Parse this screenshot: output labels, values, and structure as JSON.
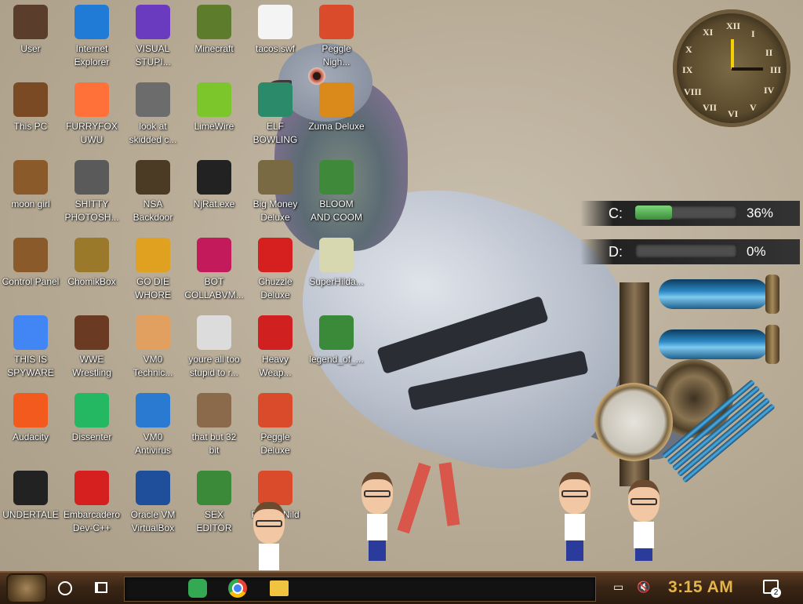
{
  "desktop": {
    "icons": [
      {
        "label": "User",
        "col": 0,
        "row": 0,
        "color": "#5a3e2b"
      },
      {
        "label": "Internet\nExplorer",
        "col": 1,
        "row": 0,
        "color": "#1f7bd6"
      },
      {
        "label": "VISUAL\nSTUPI...",
        "col": 2,
        "row": 0,
        "color": "#6b3bbf"
      },
      {
        "label": "Minecraft",
        "col": 3,
        "row": 0,
        "color": "#5d7d2c"
      },
      {
        "label": "tacos.swf",
        "col": 4,
        "row": 0,
        "color": "#f4f4f4"
      },
      {
        "label": "Peggle\nNigh...",
        "col": 5,
        "row": 0,
        "color": "#d94b2b"
      },
      {
        "label": "This PC",
        "col": 0,
        "row": 1,
        "color": "#7a4a24"
      },
      {
        "label": "FURRYFOX\nUWU",
        "col": 1,
        "row": 1,
        "color": "#ff7139"
      },
      {
        "label": "look at\nskidded c...",
        "col": 2,
        "row": 1,
        "color": "#6c6c6c"
      },
      {
        "label": "LimeWire",
        "col": 3,
        "row": 1,
        "color": "#7cc52a"
      },
      {
        "label": "ELF\nBOWLING",
        "col": 4,
        "row": 1,
        "color": "#2b8a6a"
      },
      {
        "label": "Zuma Deluxe",
        "col": 5,
        "row": 1,
        "color": "#d98a1a"
      },
      {
        "label": "moon girl",
        "col": 0,
        "row": 2,
        "color": "#8a5a2a"
      },
      {
        "label": "SHITTY\nPHOTOSH...",
        "col": 1,
        "row": 2,
        "color": "#5a5a5a"
      },
      {
        "label": "NSA\nBackdoor",
        "col": 2,
        "row": 2,
        "color": "#4b3a24"
      },
      {
        "label": "NjRat.exe",
        "col": 3,
        "row": 2,
        "color": "#222222"
      },
      {
        "label": "Big Money\nDeluxe",
        "col": 4,
        "row": 2,
        "color": "#7a6a44"
      },
      {
        "label": "BLOOM\nAND COOM",
        "col": 5,
        "row": 2,
        "color": "#3f8a3a"
      },
      {
        "label": "Control Panel",
        "col": 0,
        "row": 3,
        "color": "#8a5a2a"
      },
      {
        "label": "ChomikBox",
        "col": 1,
        "row": 3,
        "color": "#9a7a2a"
      },
      {
        "label": "GO DIE\nWHORE",
        "col": 2,
        "row": 3,
        "color": "#e0a020"
      },
      {
        "label": "BOT\nCOLLABVM...",
        "col": 3,
        "row": 3,
        "color": "#c21a5a"
      },
      {
        "label": "Chuzzle\nDeluxe",
        "col": 4,
        "row": 3,
        "color": "#d62020"
      },
      {
        "label": "SuperHilda...",
        "col": 5,
        "row": 3,
        "color": "#d8d8b0"
      },
      {
        "label": "THIS IS\nSPYWARE",
        "col": 0,
        "row": 4,
        "color": "#4285f4"
      },
      {
        "label": "WWE\nWrestling",
        "col": 1,
        "row": 4,
        "color": "#6a3a22"
      },
      {
        "label": "VM0\nTechnic...",
        "col": 2,
        "row": 4,
        "color": "#e2a060"
      },
      {
        "label": "youre all too\nstupid to r...",
        "col": 3,
        "row": 4,
        "color": "#dcdcdc"
      },
      {
        "label": "Heavy\nWeap...",
        "col": 4,
        "row": 4,
        "color": "#d02020"
      },
      {
        "label": "legend_of_...",
        "col": 5,
        "row": 4,
        "color": "#3a8a3a"
      },
      {
        "label": "Audacity",
        "col": 0,
        "row": 5,
        "color": "#f25a1e"
      },
      {
        "label": "Dissenter",
        "col": 1,
        "row": 5,
        "color": "#25b863"
      },
      {
        "label": "VM0\nAntivirus",
        "col": 2,
        "row": 5,
        "color": "#2a7ad2"
      },
      {
        "label": "that but 32\nbit",
        "col": 3,
        "row": 5,
        "color": "#8a6a4a"
      },
      {
        "label": "Peggle\nDeluxe",
        "col": 4,
        "row": 5,
        "color": "#d94b2b"
      },
      {
        "label": "UNDERTALE",
        "col": 0,
        "row": 6,
        "color": "#222222"
      },
      {
        "label": "Embarcadero\nDev-C++",
        "col": 1,
        "row": 6,
        "color": "#d62020"
      },
      {
        "label": "Oracle VM\nVirtualBox",
        "col": 2,
        "row": 6,
        "color": "#1f4f9a"
      },
      {
        "label": "SEX\nEDITOR",
        "col": 3,
        "row": 6,
        "color": "#3a8a3a"
      },
      {
        "label": "Peggle Nild\nof...",
        "col": 4,
        "row": 6,
        "color": "#d94b2b"
      }
    ]
  },
  "clock_widget": {
    "numerals": [
      "XII",
      "I",
      "II",
      "III",
      "IV",
      "V",
      "VI",
      "VII",
      "VIII",
      "IX",
      "X",
      "XI"
    ]
  },
  "drives": [
    {
      "letter": "C:",
      "percent_text": "36%",
      "fill": 0.36
    },
    {
      "letter": "D:",
      "percent_text": "0%",
      "fill": 0.0
    }
  ],
  "taskbar": {
    "time": "3:15 AM",
    "notification_count": "2",
    "pinned": [
      "hangouts-icon",
      "chrome-icon",
      "file-explorer-icon"
    ]
  }
}
